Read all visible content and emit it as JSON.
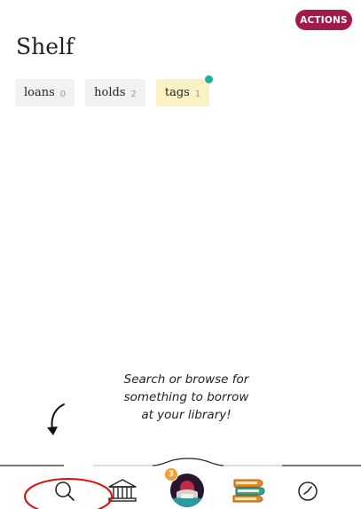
{
  "header": {
    "actions_label": "ACTIONS",
    "title": "Shelf"
  },
  "tabs": [
    {
      "label": "loans",
      "count": "0",
      "active": false
    },
    {
      "label": "holds",
      "count": "2",
      "active": false
    },
    {
      "label": "tags",
      "count": "1",
      "active": true
    }
  ],
  "empty_state": {
    "lines": [
      "Search or browse for",
      "something to borrow",
      "at your library!"
    ]
  },
  "bottom_nav": {
    "items": [
      {
        "name": "search",
        "icon": "search-icon"
      },
      {
        "name": "library",
        "icon": "library-building-icon"
      },
      {
        "name": "shelf",
        "icon": "reader-avatar-icon"
      },
      {
        "name": "books",
        "icon": "books-stack-icon"
      },
      {
        "name": "activity",
        "icon": "clock-icon"
      }
    ],
    "shelf_badge": "3"
  },
  "colors": {
    "actions_bg": "#a11a4a",
    "active_tab_bg": "#fbf2c4",
    "tab_bg": "#f2f2f2",
    "notify_dot": "#1bb0a0",
    "badge": "#f0a030",
    "annotation_red": "#e01010"
  }
}
